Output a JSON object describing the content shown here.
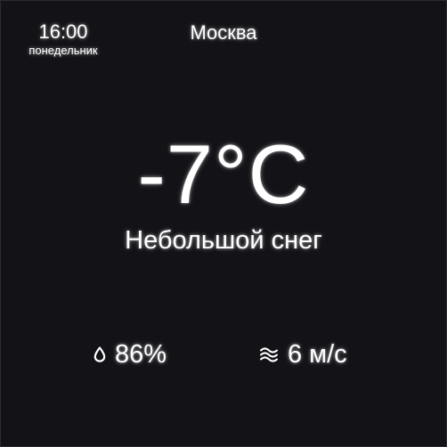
{
  "clock": {
    "time": "16:00",
    "weekday": "понедельник"
  },
  "location": {
    "city": "Москва"
  },
  "current": {
    "temperature": "-7°C",
    "condition": "Небольшой снег"
  },
  "stats": {
    "humidity": {
      "icon": "water-drop-icon",
      "value": "86%"
    },
    "wind": {
      "icon": "wind-icon",
      "value": "6 м/с"
    }
  },
  "colors": {
    "background": "#131217",
    "text": "#ffffff"
  }
}
